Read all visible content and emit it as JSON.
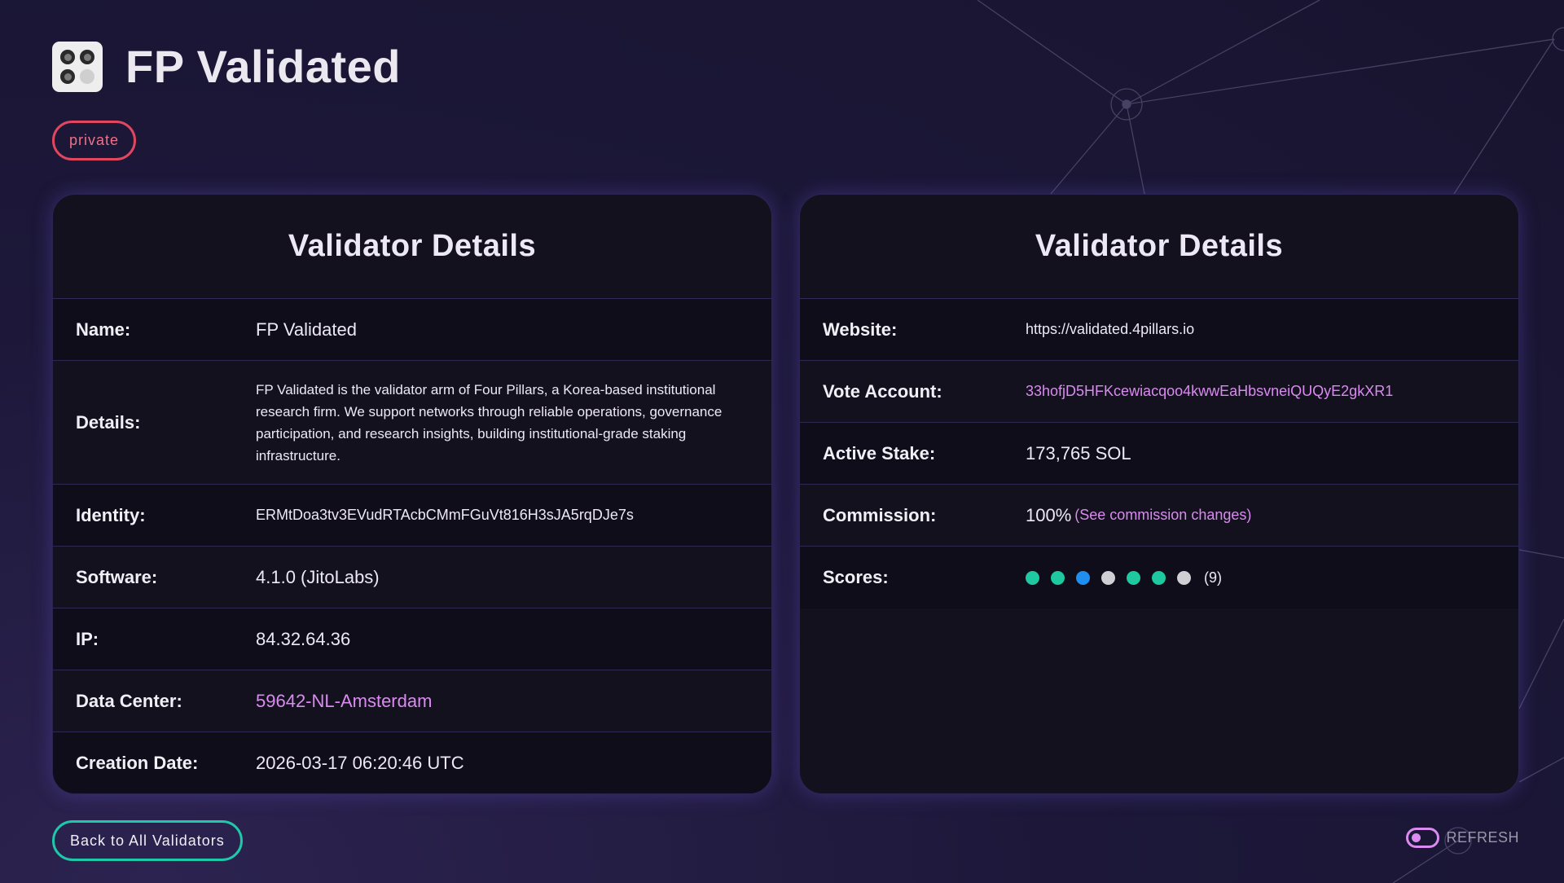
{
  "header": {
    "title": "FP Validated",
    "logo_icon": "dice-logo-icon",
    "badge": "private"
  },
  "left_card": {
    "title": "Validator Details",
    "rows": [
      {
        "label": "Name:",
        "value": "FP Validated"
      },
      {
        "label": "Details:",
        "value": "FP Validated is the validator arm of Four Pillars, a Korea-based institutional research firm. We support networks through reliable operations, governance participation, and research insights, building institutional-grade staking infrastructure."
      },
      {
        "label": "Identity:",
        "value": "ERMtDoa3tv3EVudRTAcbCMmFGuVt816H3sJA5rqDJe7s"
      },
      {
        "label": "Software:",
        "value": "4.1.0 (JitoLabs)"
      },
      {
        "label": "IP:",
        "value": "84.32.64.36"
      },
      {
        "label": "Data Center:",
        "value": "59642-NL-Amsterdam"
      },
      {
        "label": "Creation Date:",
        "value": "2026-03-17 06:20:46 UTC"
      }
    ]
  },
  "right_card": {
    "title": "Validator Details",
    "website": {
      "label": "Website:",
      "value": "https://validated.4pillars.io"
    },
    "vote_account": {
      "label": "Vote Account:",
      "value": "33hofjD5HFKcewiacqoo4kwwEaHbsvneiQUQyE2gkXR1"
    },
    "active_stake": {
      "label": "Active Stake:",
      "value": "173,765 SOL"
    },
    "commission": {
      "label": "Commission:",
      "value": "100%",
      "link": "(See commission changes)"
    },
    "scores": {
      "label": "Scores:",
      "dots": [
        "#1ec8a0",
        "#1ec8a0",
        "#1e8ff0",
        "#cfcfd4",
        "#1ec8a0",
        "#1ec8a0",
        "#cfcfd4"
      ],
      "count": "(9)"
    }
  },
  "footer": {
    "back_label": "Back to All Validators",
    "refresh_label": "REFRESH"
  },
  "colors": {
    "accent_pink": "#d98bef",
    "accent_teal": "#1ec8a8",
    "badge_red": "#e0475f"
  }
}
